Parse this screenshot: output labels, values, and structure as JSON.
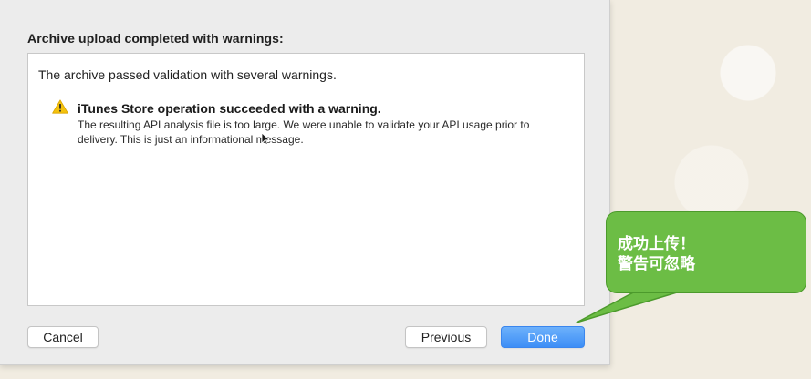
{
  "dialog": {
    "title": "Archive upload completed with warnings:",
    "summary": "The archive passed validation with several warnings.",
    "warning": {
      "icon": "warning-triangle-icon",
      "title": "iTunes Store operation succeeded with a warning.",
      "message": "The resulting API analysis file is too large.  We were unable to validate your API usage prior to delivery.  This is just an informational message."
    },
    "buttons": {
      "cancel": "Cancel",
      "previous": "Previous",
      "done": "Done"
    }
  },
  "callout": {
    "line1": "成功上传！",
    "line2": "警告可忽略"
  },
  "colors": {
    "done_button": "#3d8ef6",
    "callout_fill": "#6cbd45",
    "warning_icon": "#f4c20d"
  }
}
